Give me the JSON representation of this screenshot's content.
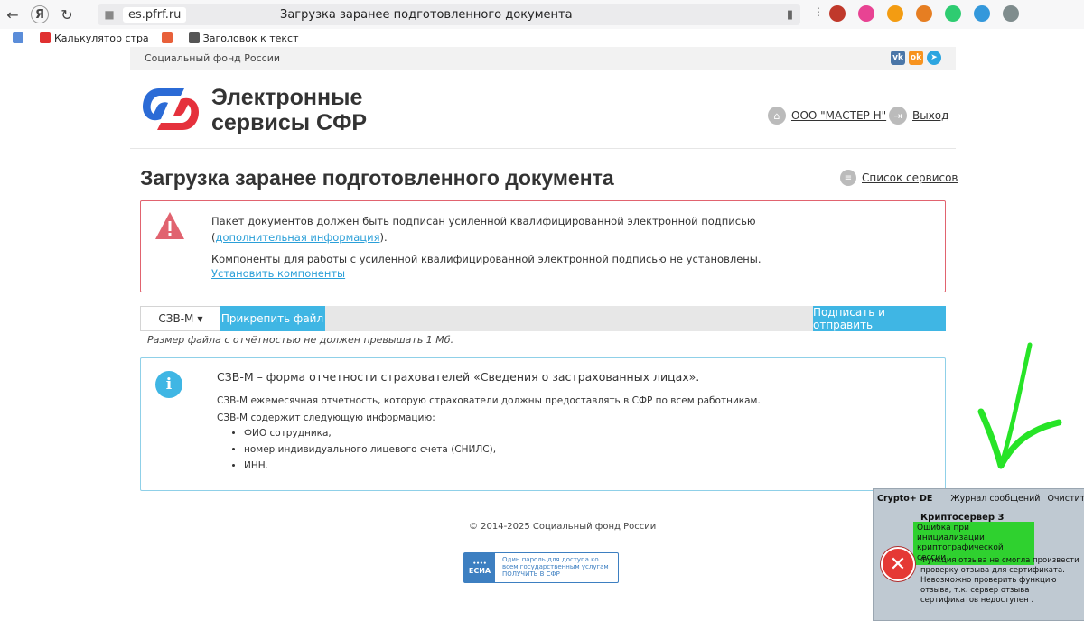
{
  "browser": {
    "domain": "es.pfrf.ru",
    "tab_title": "Загрузка заранее подготовленного документа",
    "bookmarks": [
      "Калькулятор стра",
      "Заголовок к текст"
    ]
  },
  "site": {
    "fund_name": "Социальный фонд России",
    "logo_title_line1": "Электронные",
    "logo_title_line2": "сервисы СФР",
    "org": "ООО \"МАСТЕР Н\"",
    "exit": "Выход",
    "social": {
      "vk": "vk",
      "ok": "ok",
      "tg": "tg"
    }
  },
  "page": {
    "title": "Загрузка заранее подготовленного документа",
    "services_link": "Список сервисов"
  },
  "alert": {
    "text_before": "Пакет документов должен быть подписан усиленной квалифицированной электронной подписью (",
    "link": "дополнительная информация",
    "text_after": ").",
    "line2": "Компоненты для работы с усиленной квалифицированной электронной подписью не установлены.",
    "install_link": "Установить компоненты"
  },
  "toolbar": {
    "form_select": "СЗВ-М",
    "attach_button": "Прикрепить файл",
    "send_button": "Подписать и отправить",
    "size_note": "Размер файла с отчётностью не должен превышать 1 Мб."
  },
  "info": {
    "lead": "СЗВ-М – форма отчетности страхователей «Сведения о застрахованных лицах».",
    "p1": "СЗВ-М ежемесячная отчетность, которую страхователи должны предоставлять в СФР по всем работникам.",
    "p2": "СЗВ-М содержит следующую информацию:",
    "items": [
      "ФИО сотрудника,",
      "номер индивидуального лицевого счета (СНИЛС),",
      "ИНН."
    ]
  },
  "footer": {
    "copyright": "© 2014-2025 Социальный фонд России",
    "esia_logo": "ЕСИА",
    "esia_text": "Один пароль для доступа ко всем государственным услугам ПОЛУЧИТЬ В СФР"
  },
  "crypto": {
    "app": "Crypto+ DE",
    "journal": "Журнал сообщений",
    "clear": "Очистить все...",
    "title": "Криптосервер 3",
    "error": "Ошибка при инициализации криптографической сессии",
    "description": "Функция отзыва не смогла произвести проверку отзыва для сертификата. Невозможно проверить функцию отзыва, т.к. сервер отзыва сертификатов недоступен ."
  },
  "colors": {
    "accent": "#3fb6e4",
    "alert_border": "#e1636f",
    "highlight": "#2fd12f"
  }
}
